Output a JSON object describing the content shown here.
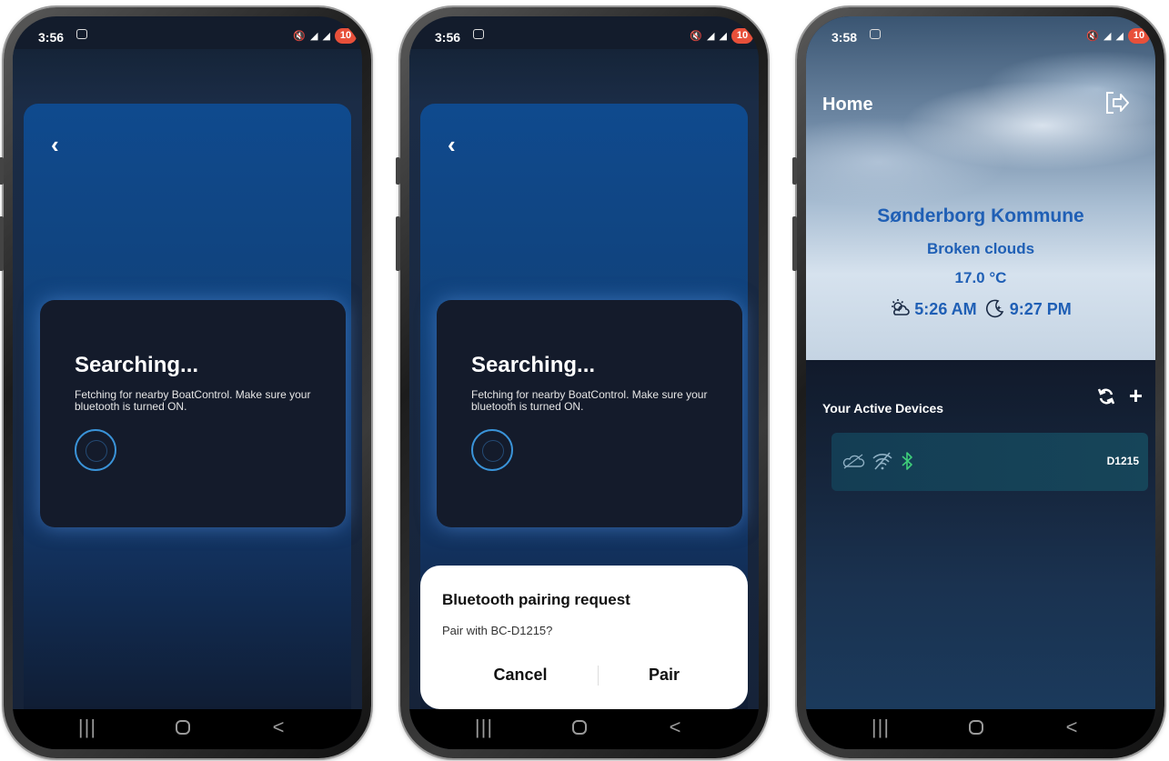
{
  "phone1": {
    "status": {
      "time": "3:56",
      "battery": "10"
    },
    "searching": {
      "title": "Searching...",
      "description": "Fetching for nearby BoatControl. Make sure your bluetooth is turned ON."
    }
  },
  "phone2": {
    "status": {
      "time": "3:56",
      "battery": "10"
    },
    "searching": {
      "title": "Searching...",
      "description": "Fetching for nearby BoatControl. Make sure your bluetooth is turned ON."
    },
    "dialog": {
      "title": "Bluetooth pairing request",
      "message": "Pair with BC-D1215?",
      "cancel_label": "Cancel",
      "pair_label": "Pair"
    }
  },
  "phone3": {
    "status": {
      "time": "3:58",
      "battery": "10"
    },
    "header": {
      "title": "Home"
    },
    "weather": {
      "location": "Sønderborg Kommune",
      "condition": "Broken clouds",
      "temperature": "17.0 °C",
      "sunrise": "5:26 AM",
      "sunset": "9:27 PM"
    },
    "devices": {
      "section_label": "Your Active Devices",
      "items": [
        {
          "id": "D1215",
          "icons": [
            "cloud-icon",
            "wifi-off-icon",
            "bluetooth-icon"
          ]
        }
      ]
    }
  },
  "colors": {
    "accent_blue": "#1f5fb5",
    "spinner": "#3a93d8",
    "battery": "#e8503a",
    "bluetooth_green": "#3ecf7a"
  }
}
